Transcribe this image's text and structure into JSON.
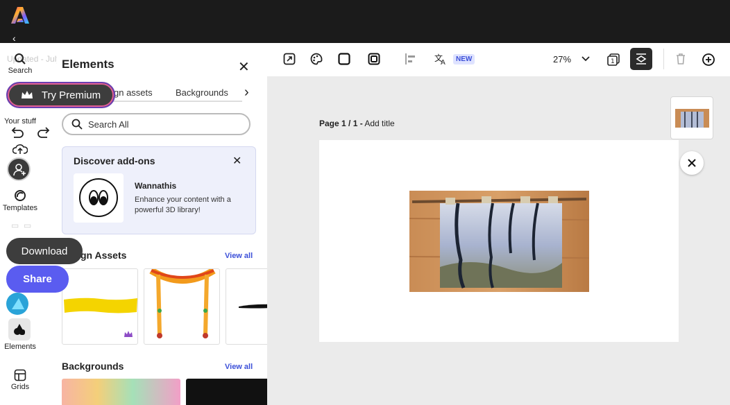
{
  "app": {
    "ghost_status": "Updated - July 25, 2024 at 16.36.45"
  },
  "rail": {
    "search_label": "Search",
    "your_stuff_label": "Your stuff",
    "templates_label": "Templates",
    "elements_label": "Elements",
    "grids_label": "Grids"
  },
  "actions": {
    "premium_label": "Try Premium",
    "download_label": "Download",
    "share_label": "Share"
  },
  "panel": {
    "title": "Elements",
    "tabs": [
      "gn assets",
      "Backgrounds"
    ],
    "search_placeholder": "Search All",
    "addons": {
      "heading": "Discover add-ons",
      "name": "Wannathis",
      "description": "Enhance your content with a powerful 3D library!"
    },
    "design_assets_title": "gn Assets",
    "view_all": "View all",
    "backgrounds_title": "Backgrounds"
  },
  "toolbar": {
    "new_badge": "NEW",
    "zoom": "27%"
  },
  "canvas": {
    "page_label": "Page 1 / 1 -",
    "page_title_placeholder": "Add title"
  },
  "colors": {
    "topbar": "#1b1b1b",
    "share": "#5a5cf0",
    "accent_link": "#3b4fd8",
    "canvas_bg": "#ebebeb"
  }
}
